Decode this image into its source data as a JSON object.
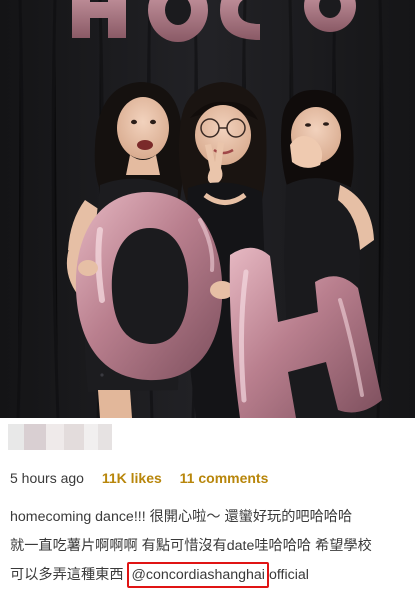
{
  "photo": {
    "top_balloons_text": "HOCO",
    "big_balloons_text": "OH"
  },
  "post": {
    "time": "5 hours ago",
    "likes": "11K likes",
    "comments": "11 comments",
    "caption_line1": "homecoming dance!!! 很開心啦～ 還蠻好玩的吧哈哈哈",
    "caption_line2": "就一直吃薯片啊啊啊 有點可惜沒有date哇哈哈哈 希望學校",
    "caption_line3_prefix": "可以多弄這種東西 ",
    "mention_highlighted": "@concordiashanghai",
    "mention_rest": "official"
  },
  "colors": {
    "accent_stats": "#b8860b",
    "highlight_box": "#e01414",
    "balloon_rose": "#c98a96"
  }
}
